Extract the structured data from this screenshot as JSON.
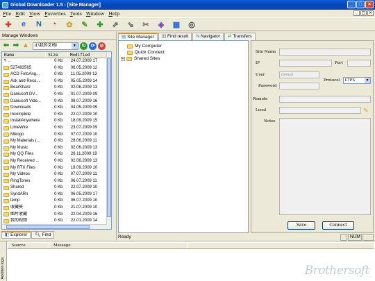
{
  "window": {
    "title": "Global Downloader 1.5 - [Site Manager]",
    "buttons": [
      "_",
      "□",
      "×"
    ],
    "mdi_buttons": [
      "_",
      "□",
      "×"
    ]
  },
  "menu": [
    {
      "hotkey": "F",
      "rest": "ile"
    },
    {
      "hotkey": "E",
      "rest": "dit"
    },
    {
      "hotkey": "V",
      "rest": "iew"
    },
    {
      "hotkey": "F",
      "rest": "avorites"
    },
    {
      "hotkey": "T",
      "rest": "ools"
    },
    {
      "hotkey": "W",
      "rest": "indow"
    },
    {
      "hotkey": "H",
      "rest": "elp"
    }
  ],
  "toolbar": {
    "icons": [
      {
        "name": "new-connection-icon",
        "glyph": "✚",
        "color": "#d23c2c"
      },
      {
        "name": "internet-explorer-icon",
        "glyph": "e",
        "color": "#1f6fd8"
      },
      {
        "name": "netscape-icon",
        "glyph": "N",
        "color": "#2a6a9a"
      },
      {
        "name": "opera-icon",
        "glyph": "◔",
        "color": "#cc2222"
      },
      {
        "name": "settings-icon",
        "glyph": "✿",
        "color": "#c9a227"
      },
      {
        "name": "edit-icon",
        "glyph": "✎",
        "color": "#4a9a2a"
      },
      {
        "name": "add-download-icon",
        "glyph": "✚",
        "color": "#2a9a2a"
      },
      {
        "name": "start-download-icon",
        "glyph": "⇗",
        "color": "#555555"
      },
      {
        "name": "stop-download-icon",
        "glyph": "⇘",
        "color": "#555555"
      },
      {
        "name": "delete-icon",
        "glyph": "✂",
        "color": "#666666"
      },
      {
        "name": "schedule-icon",
        "glyph": "◈",
        "color": "#7a4ab8"
      },
      {
        "name": "stats-icon",
        "glyph": "▦",
        "color": "#2a6ad8"
      },
      {
        "name": "exit-icon",
        "glyph": "◎",
        "color": "#444444"
      }
    ]
  },
  "left_panel": {
    "header": "Manage Windows",
    "path": "d:\\我的文档\\",
    "columns": {
      "name": "Name",
      "size": "Size",
      "modified": "Modified"
    },
    "files": [
      {
        "name": "..",
        "size": "0 Kb",
        "modified": "24.07.2009 17",
        "type": "up"
      },
      {
        "name": "527493565",
        "size": "0 Kb",
        "modified": "06.05.2009 12",
        "type": "folder"
      },
      {
        "name": "ACD FotoAng...",
        "size": "0 Kb",
        "modified": "11.05.2009 13",
        "type": "folder"
      },
      {
        "name": "Ask and Reco...",
        "size": "0 Kb",
        "modified": "05.05.2009 14",
        "type": "folder"
      },
      {
        "name": "BearShare",
        "size": "0 Kb",
        "modified": "02.06.2009 13",
        "type": "folder"
      },
      {
        "name": "Daniusoft DV...",
        "size": "0 Kb",
        "modified": "01.07.2009 09",
        "type": "folder"
      },
      {
        "name": "Daniusoft Vide...",
        "size": "0 Kb",
        "modified": "08.07.2009 16",
        "type": "folder"
      },
      {
        "name": "Downloads",
        "size": "0 Kb",
        "modified": "04.05.2009 09",
        "type": "folder"
      },
      {
        "name": "Incomplete",
        "size": "0 Kb",
        "modified": "22.07.2009 10",
        "type": "folder"
      },
      {
        "name": "InstallAnywhere",
        "size": "0 Kb",
        "modified": "18.09.2009 15",
        "type": "folder"
      },
      {
        "name": "LimeWire",
        "size": "0 Kb",
        "modified": "23.07.2009 09",
        "type": "folder"
      },
      {
        "name": "Mikogo",
        "size": "0 Kb",
        "modified": "07.07.2009 10",
        "type": "folder"
      },
      {
        "name": "My Materials (...",
        "size": "0 Kb",
        "modified": "28.06.2009 11",
        "type": "folder"
      },
      {
        "name": "My Music",
        "size": "0 Kb",
        "modified": "02.06.2009 13",
        "type": "folder"
      },
      {
        "name": "My QQ Files",
        "size": "0 Kb",
        "modified": "26.11.2009 19",
        "type": "folder"
      },
      {
        "name": "My Received ...",
        "size": "0 Kb",
        "modified": "02.06.2009 13",
        "type": "folder"
      },
      {
        "name": "My RTX Files",
        "size": "0 Kb",
        "modified": "18.09.2009 10",
        "type": "folder"
      },
      {
        "name": "My Videos",
        "size": "0 Kb",
        "modified": "07.07.2009 11",
        "type": "folder"
      },
      {
        "name": "RingTones",
        "size": "0 Kb",
        "modified": "06.07.2009 11",
        "type": "folder"
      },
      {
        "name": "Shared",
        "size": "0 Kb",
        "modified": "22.07.2009 10",
        "type": "folder"
      },
      {
        "name": "SyndARn",
        "size": "0 Kb",
        "modified": "06.05.2009 17",
        "type": "folder"
      },
      {
        "name": "temp",
        "size": "0 Kb",
        "modified": "06.07.2009 10",
        "type": "folder"
      },
      {
        "name": "收藏夹",
        "size": "0 Kb",
        "modified": "21.07.2009 10",
        "type": "folder"
      },
      {
        "name": "图片收藏",
        "size": "0 Kb",
        "modified": "22.04.2009 16",
        "type": "folder"
      },
      {
        "name": "我的视频",
        "size": "0 Kb",
        "modified": "22.01.2009 14",
        "type": "folder"
      }
    ],
    "tabs": [
      {
        "label": "Explorer",
        "active": true
      },
      {
        "label": "Find",
        "active": false
      }
    ]
  },
  "main_tabs": [
    {
      "label": "Site Manager",
      "active": true
    },
    {
      "label": "Find result",
      "active": false
    },
    {
      "label": "Navigator",
      "active": false
    },
    {
      "label": "Transfers",
      "active": false
    }
  ],
  "tree": [
    {
      "label": "My Computer",
      "expander": ""
    },
    {
      "label": "Quick Connect",
      "expander": ""
    },
    {
      "label": "Shared Sites",
      "expander": "+"
    }
  ],
  "form": {
    "site_name_label": "Site Name",
    "ip_label": "IP",
    "port_label": "Port",
    "user_label": "User",
    "user_placeholder": "Default",
    "password_label": "Password",
    "protocol_label": "Protocol",
    "protocol_value": "FTPS",
    "remote_label": "Remote",
    "local_label": "Local",
    "notes_label": "Notes",
    "save_label": "Save",
    "connect_label": "Connect"
  },
  "status": {
    "text": "Ready",
    "num": "NUM"
  },
  "log": {
    "side_label": "Addition logs",
    "columns": {
      "source": "Source",
      "message": "Message"
    }
  },
  "watermark": "Brothersoft"
}
